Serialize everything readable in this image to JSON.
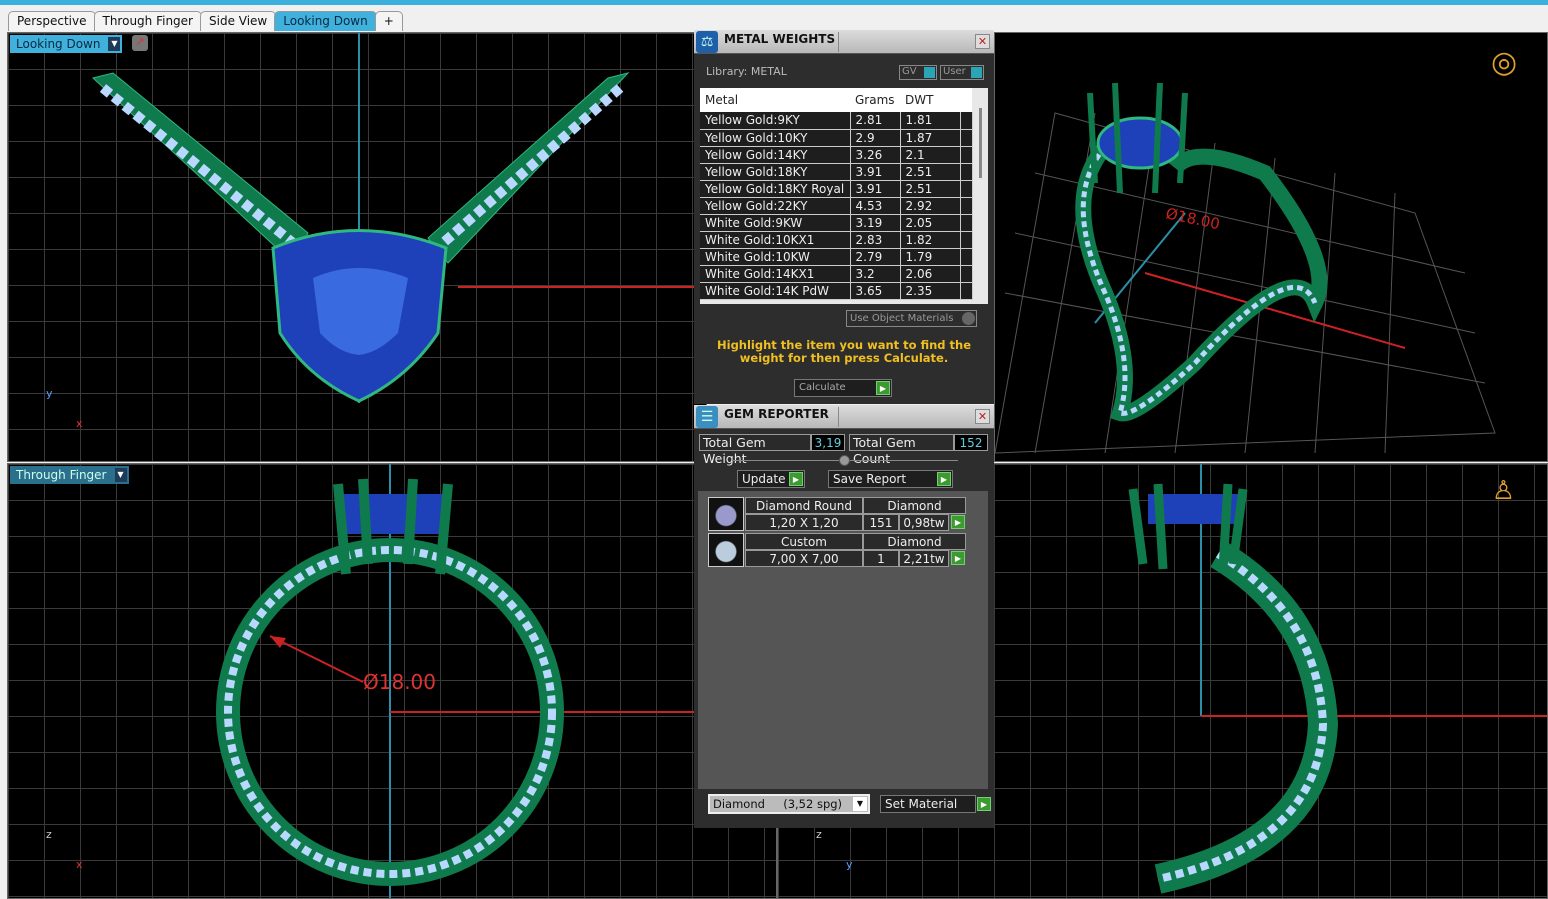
{
  "tabs": [
    "Perspective",
    "Through Finger",
    "Side View",
    "Looking Down"
  ],
  "add_tab_icon": "+",
  "viewports": {
    "top_left": {
      "label": "Looking Down",
      "axes": [
        "y",
        "x"
      ]
    },
    "bottom_left": {
      "label": "Through Finger",
      "axes": [
        "z",
        "x"
      ],
      "dimension": "Ø18.00"
    },
    "top_right": {
      "dimension": "Ø18.00"
    },
    "bottom_right": {
      "axes": [
        "z",
        "y"
      ]
    }
  },
  "metal_weights": {
    "title": "METAL WEIGHTS",
    "library": "Library: METAL",
    "toggle_gv": "GV",
    "toggle_user": "User",
    "columns": [
      "Metal",
      "Grams",
      "DWT"
    ],
    "rows": [
      [
        "Yellow Gold:9KY",
        "2.81",
        "1.81"
      ],
      [
        "Yellow Gold:10KY",
        "2.9",
        "1.87"
      ],
      [
        "Yellow Gold:14KY",
        "3.26",
        "2.1"
      ],
      [
        "Yellow Gold:18KY",
        "3.91",
        "2.51"
      ],
      [
        "Yellow Gold:18KY Royal",
        "3.91",
        "2.51"
      ],
      [
        "Yellow Gold:22KY",
        "4.53",
        "2.92"
      ],
      [
        "White Gold:9KW",
        "3.19",
        "2.05"
      ],
      [
        "White Gold:10KX1",
        "2.83",
        "1.82"
      ],
      [
        "White Gold:10KW",
        "2.79",
        "1.79"
      ],
      [
        "White Gold:14KX1",
        "3.2",
        "2.06"
      ],
      [
        "White Gold:14K PdW",
        "3.65",
        "2.35"
      ]
    ],
    "use_object_materials": "Use Object Materials",
    "hint": "Highlight the item you want to find the weight for then press Calculate.",
    "calculate": "Calculate"
  },
  "gem_reporter": {
    "title": "GEM REPORTER",
    "total_weight_label": "Total Gem Weight",
    "total_weight": "3,19",
    "total_count_label": "Total Gem Count",
    "total_count": "152",
    "update": "Update",
    "save_report": "Save Report",
    "gems": [
      {
        "shape": "Diamond Round",
        "material": "Diamond",
        "size": "1,20 X 1,20",
        "count": "151",
        "weight": "0,98tw"
      },
      {
        "shape": "Custom",
        "material": "Diamond",
        "size": "7,00 X 7,00",
        "count": "1",
        "weight": "2,21tw"
      }
    ],
    "material_select": "Diamond     (3,52 spg)",
    "set_material": "Set Material"
  }
}
